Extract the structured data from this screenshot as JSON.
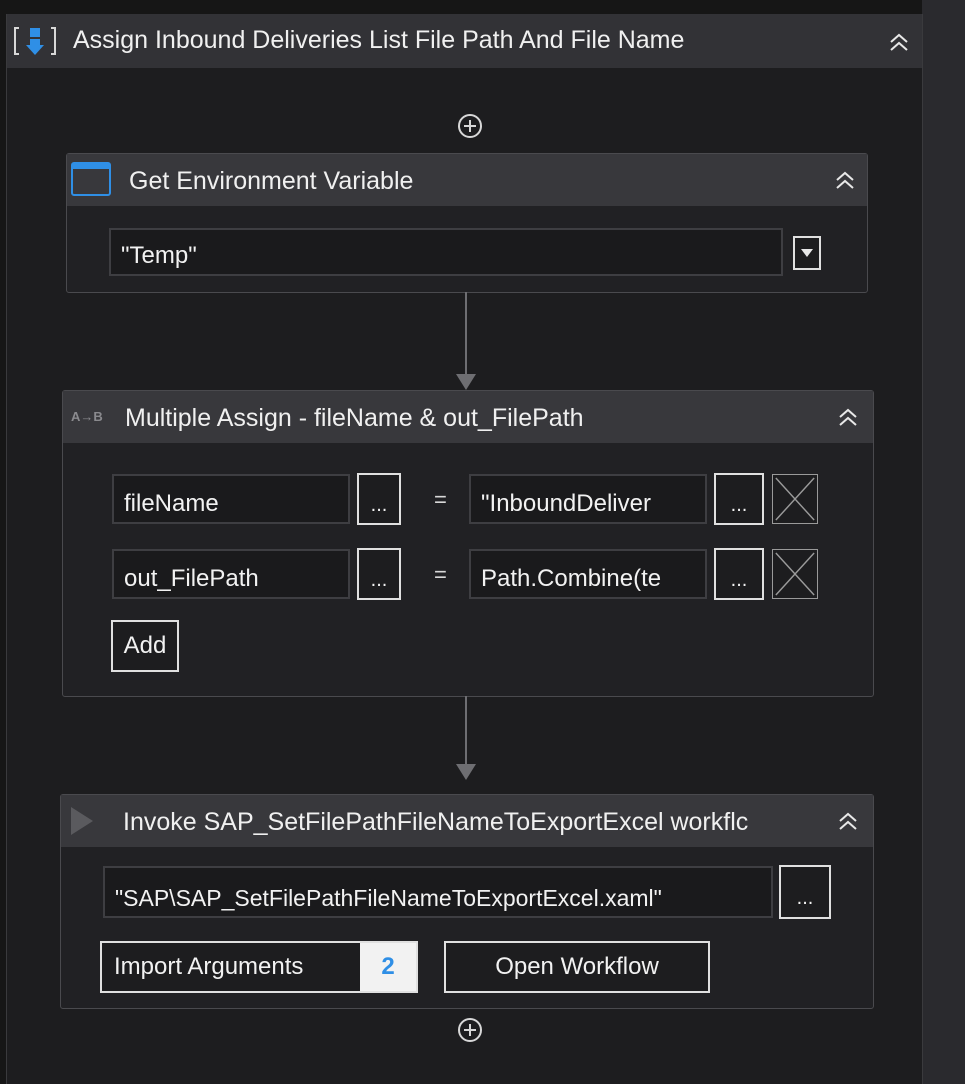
{
  "sequence": {
    "title": "Assign Inbound Deliveries List File Path And File Name",
    "icon": "sequence-icon"
  },
  "get_env": {
    "title": "Get Environment Variable",
    "icon": "window-icon",
    "value": "\"Temp\""
  },
  "multi_assign": {
    "title": "Multiple Assign - fileName & out_FilePath",
    "icon_label": "A→B",
    "rows": [
      {
        "target": "fileName",
        "value": "\"InboundDeliver"
      },
      {
        "target": "out_FilePath",
        "value": "Path.Combine(te"
      }
    ],
    "ellipsis": "...",
    "equals": "=",
    "add_label": "Add"
  },
  "invoke": {
    "title": "Invoke SAP_SetFilePathFileNameToExportExcel workflc",
    "icon": "play-icon",
    "file": "\"SAP\\SAP_SetFilePathFileNameToExportExcel.xaml\"",
    "ellipsis": "...",
    "import_label": "Import Arguments",
    "import_count": "2",
    "open_label": "Open Workflow"
  },
  "colors": {
    "accent": "#2f8fe6",
    "header": "#38383c",
    "background": "#1d1d1f"
  }
}
